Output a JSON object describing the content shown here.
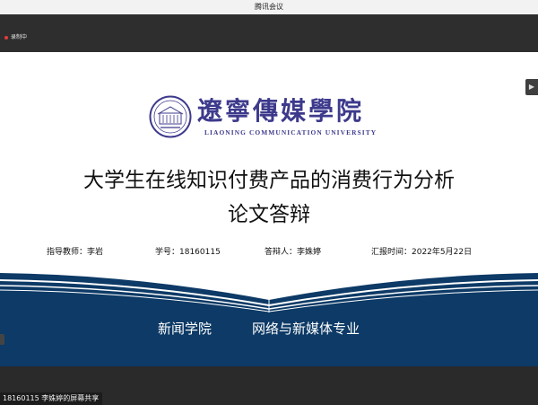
{
  "window": {
    "title": "腾讯会议"
  },
  "recording": {
    "label": "录制中"
  },
  "slide": {
    "logo": {
      "name_cn": "遼寧傳媒學院",
      "name_en": "LIAONING COMMUNICATION UNIVERSITY"
    },
    "title_line1": "大学生在线知识付费产品的消费行为分析",
    "title_line2": "论文答辩",
    "meta": {
      "advisor": "指导教师：李岩",
      "student_id": "学号：18160115",
      "defender": "答辩人：李姝婷",
      "date": "汇报时间：2022年5月22日"
    },
    "footer": {
      "college": "新闻学院",
      "major": "网络与新媒体专业"
    },
    "colors": {
      "navy": "#0d3a66",
      "logo_purple": "#3d3a8c"
    }
  },
  "share": {
    "label": "18160115 李姝婷的屏幕共享"
  },
  "icons": {
    "side_toggle": "expand-icon",
    "recording": "record-dot-icon"
  }
}
